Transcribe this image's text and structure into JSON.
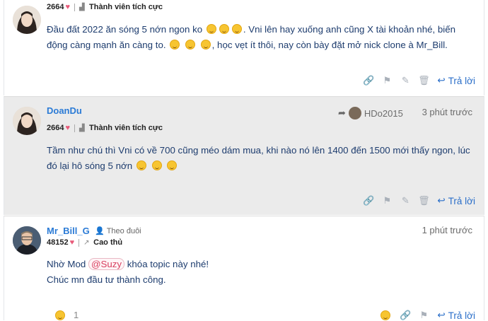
{
  "posts": [
    {
      "username": "",
      "points": "2664",
      "rank": "Thành viên tích cực",
      "time": "",
      "content_lines": [
        "Đầu đất 2022 ăn sóng 5 nớn ngon ko",
        ". Vni lên hay xuống anh cũng X tài khoản nhé, biến",
        "động càng mạnh ăn càng to.",
        ", học vẹt ít thôi, nay còn bày đặt mở nick clone à Mr_Bill."
      ],
      "reply_label": "Trả lời"
    },
    {
      "username": "DoanDu",
      "points": "2664",
      "rank": "Thành viên tích cực",
      "reply_to": "HDo2015",
      "time": "3 phút trước",
      "content_lines": [
        "Tầm như chú thì Vni có về 700 cũng méo dám mua, khi nào nó lên 1400 đến 1500 mới thấy ngon, lúc",
        "đó lại hô sóng 5 nớn"
      ],
      "reply_label": "Trả lời"
    },
    {
      "username": "Mr_Bill_G",
      "follow_label": "Theo đuôi",
      "points": "48152",
      "rank": "Cao thủ",
      "time": "1 phút trước",
      "content_pre": "Nhờ Mod",
      "mention": "@Suzy",
      "content_post": "khóa topic này nhé!",
      "content_line2": "Chúc mn đầu tư thành công.",
      "reaction_count": "1",
      "reply_label": "Trả lời"
    }
  ],
  "colors": {
    "link": "#2b7bd6",
    "text": "#1d3c6e",
    "alt_bg": "#ebebeb"
  },
  "icons": [
    "link-icon",
    "flag-icon",
    "edit-icon",
    "trash-icon",
    "reply-arrow-icon",
    "smile-icon"
  ]
}
